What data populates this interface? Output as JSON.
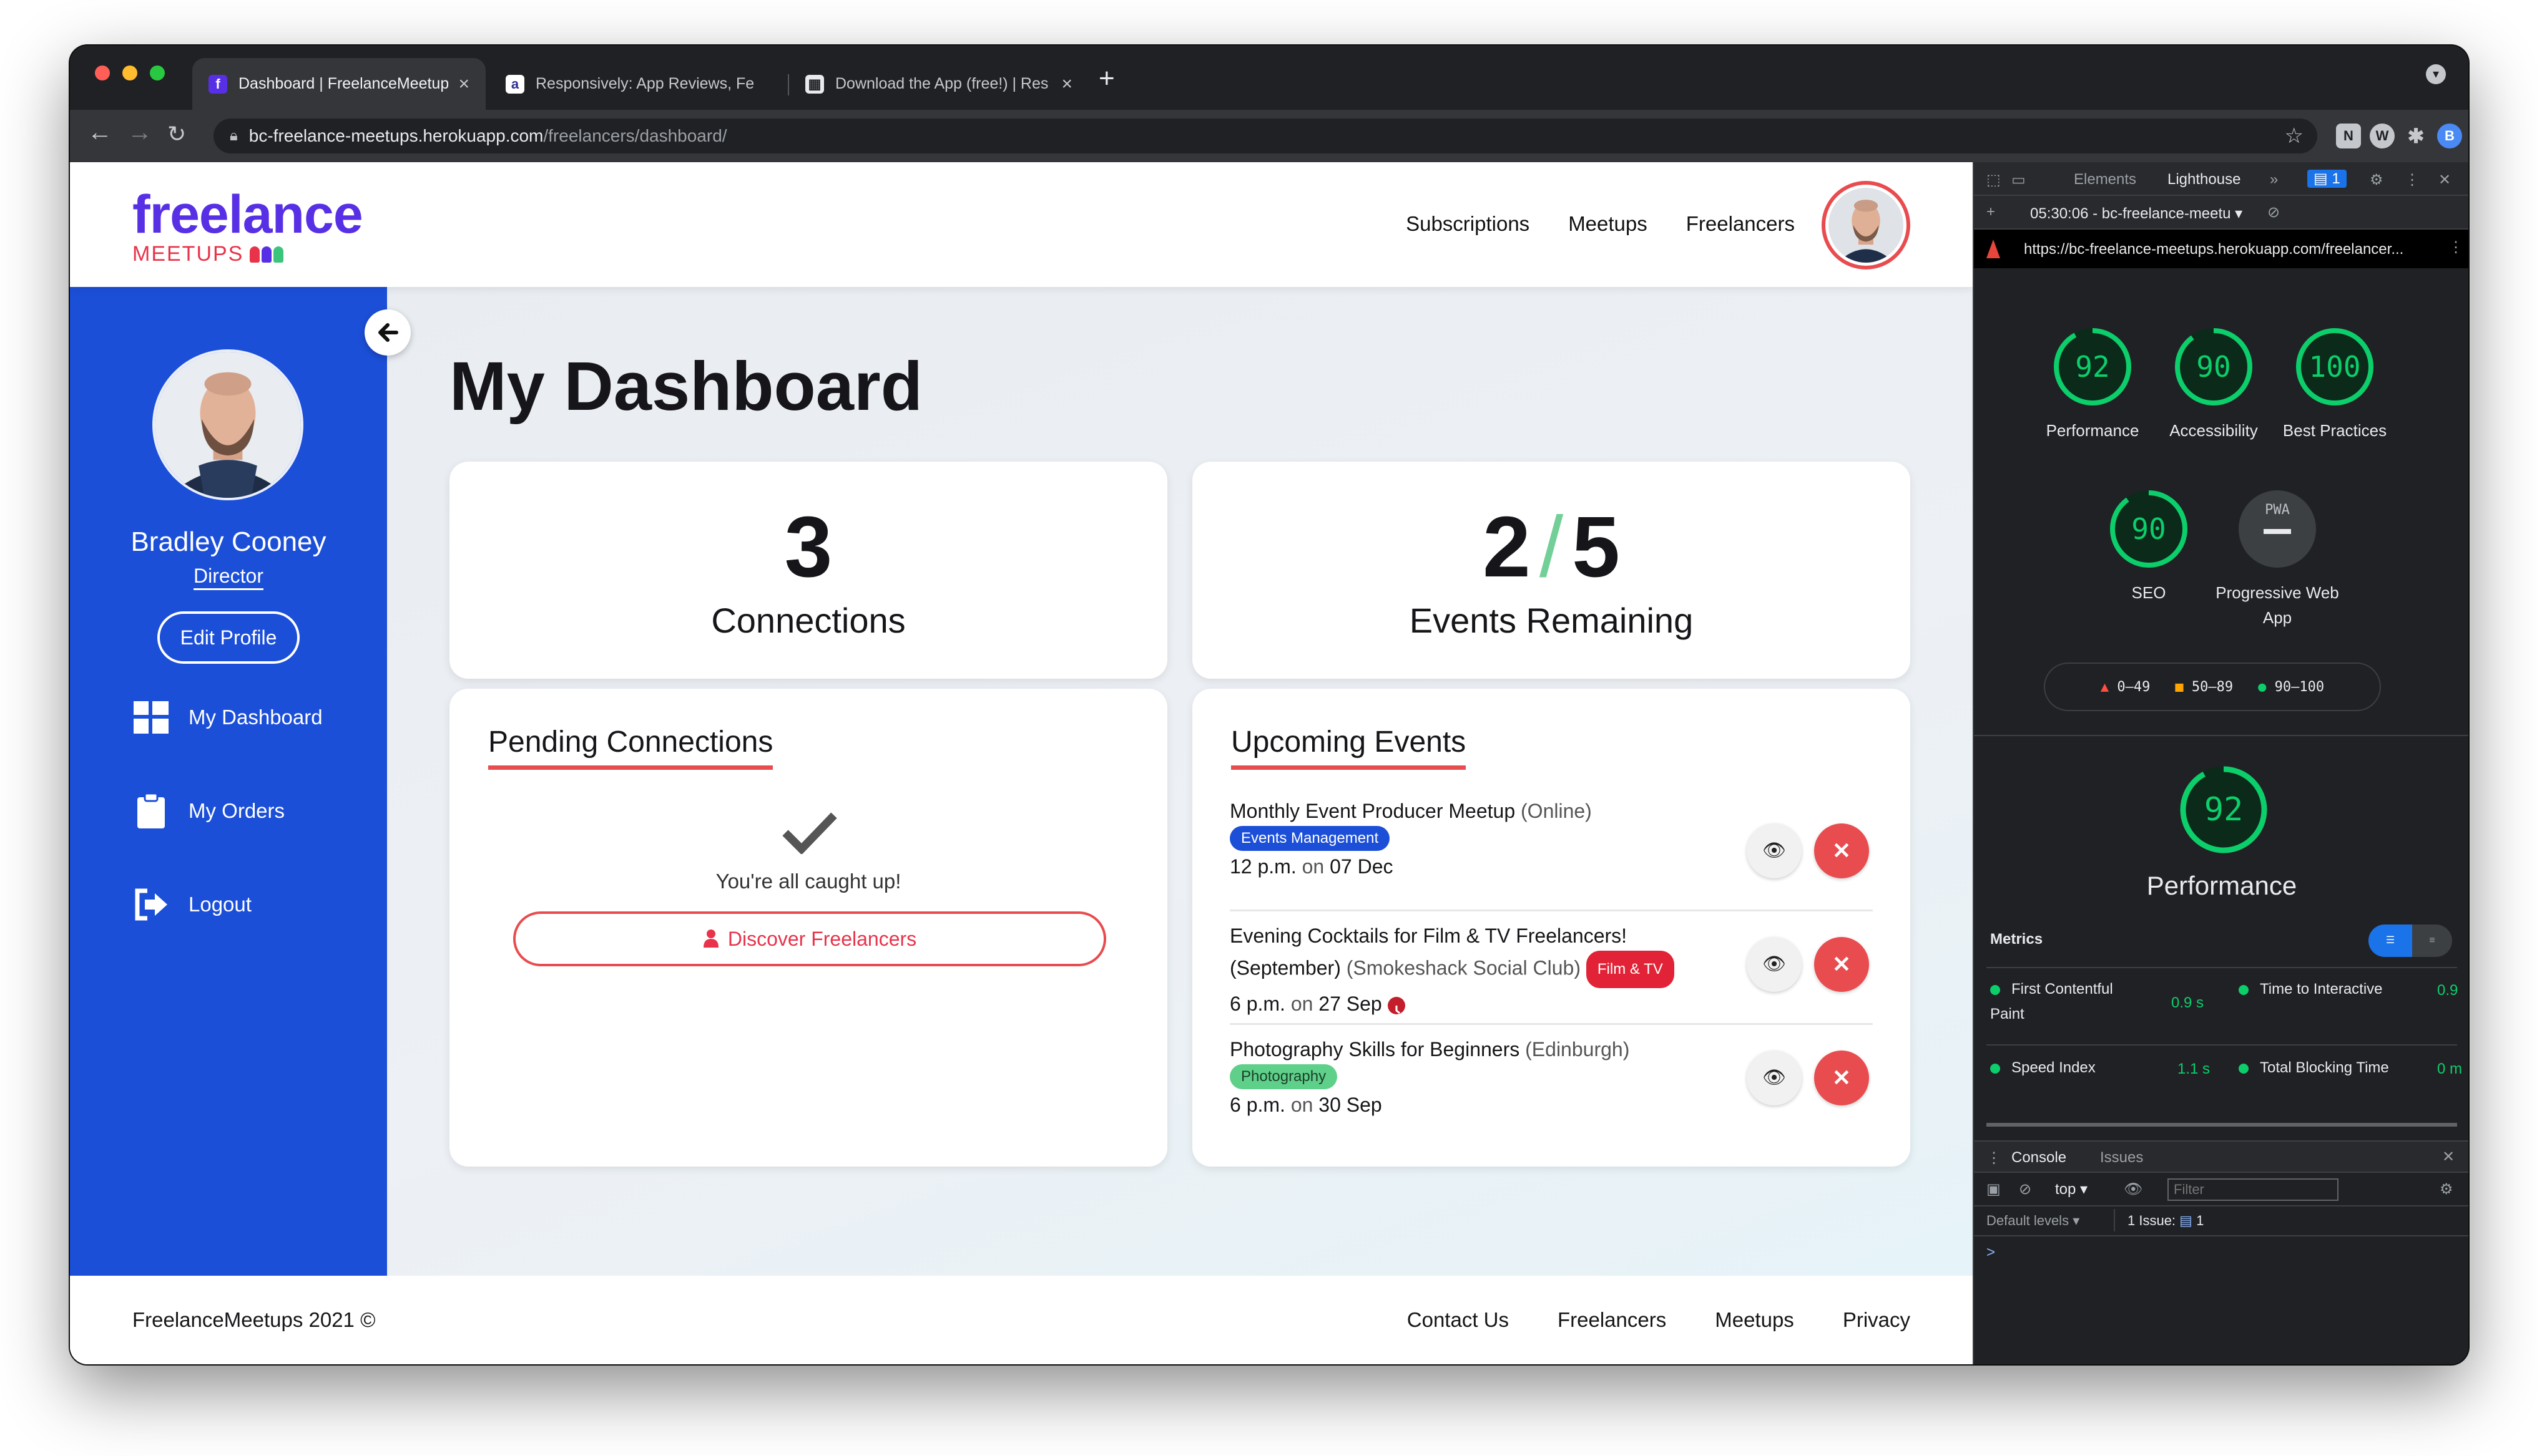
{
  "browser": {
    "tabs": [
      {
        "title": "Dashboard | FreelanceMeetups"
      },
      {
        "title": "Responsively: App Reviews, Fe"
      },
      {
        "title": "Download the App (free!) | Res"
      }
    ],
    "url_host": "bc-freelance-meetups.herokuapp.com",
    "url_path": "/freelancers/dashboard/",
    "profile_initial": "B"
  },
  "site": {
    "logo_word": "freelance",
    "logo_sub": "MEETUPS",
    "nav": [
      "Subscriptions",
      "Meetups",
      "Freelancers"
    ],
    "sidebar": {
      "name": "Bradley Cooney",
      "role": "Director",
      "edit_label": "Edit Profile",
      "items": [
        {
          "label": "My Dashboard",
          "icon": "grid-icon"
        },
        {
          "label": "My Orders",
          "icon": "clipboard-icon"
        },
        {
          "label": "Logout",
          "icon": "logout-icon"
        }
      ]
    },
    "page_title": "My Dashboard",
    "connections": {
      "count": "3",
      "label": "Connections"
    },
    "events_remaining": {
      "used": "2",
      "total": "5",
      "label": "Events Remaining"
    },
    "pending": {
      "heading": "Pending Connections",
      "empty_text": "You're all caught up!",
      "button_label": "Discover Freelancers"
    },
    "upcoming": {
      "heading": "Upcoming Events",
      "events": [
        {
          "title": "Monthly Event Producer Meetup",
          "venue": "(Online)",
          "tag": "Events Management",
          "tag_color": "#1c4fd8",
          "time": "12 p.m.",
          "on": "on",
          "date": "07 Dec"
        },
        {
          "title": "Evening Cocktails for Film & TV Freelancers! (September)",
          "venue": "(Smokeshack Social Club)",
          "tag": "Film & TV",
          "tag_color": "#e22236",
          "time": "6 p.m.",
          "on": "on",
          "date": "27 Sep"
        },
        {
          "title": "Photography Skills for Beginners",
          "venue": "(Edinburgh)",
          "tag": "Photography",
          "tag_color": "#5fd08a",
          "time": "6 p.m.",
          "on": "on",
          "date": "30 Sep"
        }
      ]
    },
    "footer": {
      "copyright": "FreelanceMeetups 2021 ©",
      "links": [
        "Contact Us",
        "Freelancers",
        "Meetups",
        "Privacy"
      ]
    }
  },
  "devtools": {
    "tabs": [
      "Elements",
      "Lighthouse"
    ],
    "issue_count": "1",
    "report_label": "05:30:06 - bc-freelance-meetu",
    "report_url": "https://bc-freelance-meetups.herokuapp.com/freelancer...",
    "scores": [
      {
        "label": "Performance",
        "value": "92"
      },
      {
        "label": "Accessibility",
        "value": "90"
      },
      {
        "label": "Best Practices",
        "value": "100"
      },
      {
        "label": "SEO",
        "value": "90"
      },
      {
        "label": "Progressive Web App",
        "value": "PWA"
      }
    ],
    "legend": [
      "0–49",
      "50–89",
      "90–100"
    ],
    "perf_score": "92",
    "perf_title": "Performance",
    "metrics_label": "Metrics",
    "metrics": [
      {
        "name": "First Contentful Paint",
        "value": "0.9 s"
      },
      {
        "name": "Time to Interactive",
        "value": "0.9"
      },
      {
        "name": "Speed Index",
        "value": "1.1 s"
      },
      {
        "name": "Total Blocking Time",
        "value": "0 m"
      }
    ],
    "console": {
      "tabs": [
        "Console",
        "Issues"
      ],
      "context": "top",
      "filter_placeholder": "Filter",
      "levels": "Default levels",
      "issues": "1 Issue:",
      "issues_count": "1",
      "prompt": ">"
    },
    "colors": {
      "pass": "#0cce6b",
      "average": "#ffa400",
      "fail": "#ff4e42"
    }
  }
}
